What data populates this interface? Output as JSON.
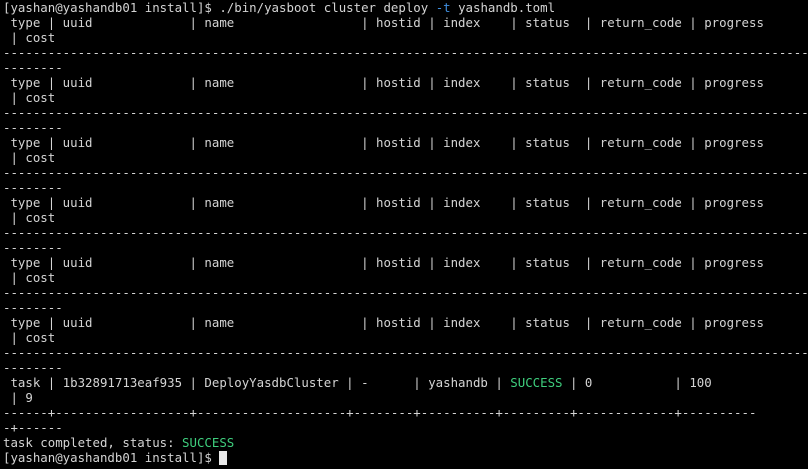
{
  "terminal": {
    "prompt": "[yashan@yashandb01 install]$ ",
    "command": {
      "exe": "./bin/yasboot cluster deploy ",
      "flag": "-t",
      "arg": " yashandb.toml"
    },
    "header_line1": " type | uuid             | name                 | hostid | index    | status  | return_code | progress",
    "header_line2": " | cost",
    "dash_line": "------------------------------------------------------------------------------------------------------------",
    "dash_tail": "--------",
    "task_row": {
      "part1": " task | 1b32891713eaf935 | DeployYasdbCluster | -      | yashandb | ",
      "status": "SUCCESS",
      "part2": " | 0           | 100",
      "cont": " | 9"
    },
    "table_sep1": "------+------------------+--------------------+--------+----------+---------+-------------+----------",
    "table_sep2": "-+------",
    "summary": {
      "text": "task completed, status: ",
      "status": "SUCCESS"
    },
    "colors": {
      "background": "#000000",
      "text": "#d4d4d4",
      "success": "#3fcf7e",
      "flag": "#3f8fe0"
    }
  }
}
